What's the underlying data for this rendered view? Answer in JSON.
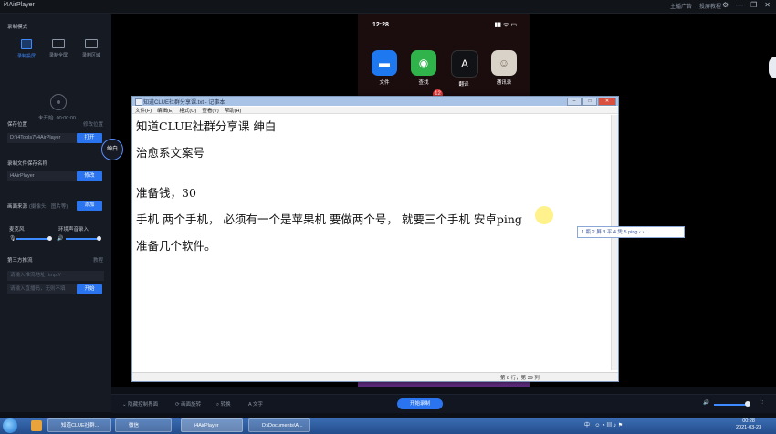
{
  "app": {
    "title": "i4AirPlayer"
  },
  "titlebar": {
    "links": [
      "主播广告",
      "投屏教程"
    ],
    "controls": [
      "⚙",
      "—",
      "❐",
      "✕"
    ]
  },
  "sidebar": {
    "record_mode_title": "录制模式",
    "modes": [
      {
        "label": "录制投屏",
        "active": true
      },
      {
        "label": "录制全屏",
        "active": false
      },
      {
        "label": "录制区域",
        "active": false
      }
    ],
    "record_status": "未开始",
    "record_time": "00:00:00",
    "save_location": {
      "title": "保存位置",
      "open_link": "修改位置",
      "path": "D:\\i4Tools7\\i4AirPlayer",
      "button": "打开"
    },
    "filename": {
      "title": "录制文件保存名称",
      "value": "i4AirPlayer",
      "button": "修改"
    },
    "image_source": {
      "title": "画面来源",
      "placeholder": "(摄像头、图片等)",
      "button": "添加"
    },
    "mic": {
      "label": "麦克风",
      "level": 0.95
    },
    "ambient": {
      "label": "环境声音录入",
      "level": 0.95
    },
    "third_party": {
      "title": "第三方推流",
      "link": "教程",
      "url_placeholder": "请输入推流地址 rtmp://",
      "key_placeholder": "请输入直播码，无则不填",
      "button": "开始"
    }
  },
  "phone": {
    "time": "12:28",
    "status_icons": "▮▮ ᯤ ▭",
    "apps": [
      {
        "label": "文件",
        "icon": "folder-icon",
        "color": "#1e78f0",
        "glyph": "▬"
      },
      {
        "label": "查找",
        "icon": "find-my-icon",
        "color": "#2fb34a",
        "glyph": "◉"
      },
      {
        "label": "翻译",
        "icon": "translate-icon",
        "color": "#101216",
        "glyph": "A"
      },
      {
        "label": "通讯录",
        "icon": "contacts-icon",
        "color": "#d8d2c8",
        "glyph": "☺"
      }
    ],
    "badge": "12"
  },
  "notepad": {
    "title": "知道CLUE社群分享课.txt - 记事本",
    "menu": [
      "文件(F)",
      "编辑(E)",
      "格式(O)",
      "查看(V)",
      "帮助(H)"
    ],
    "lines": [
      "知道CLUE社群分享课   绅白",
      "治愈系文案号",
      "准备钱，30",
      "手机 两个手机，  必须有一个是苹果机  要做两个号，  就要三个手机  安卓ping",
      "准备几个软件。"
    ],
    "status": "第 8 行，第 39 列"
  },
  "ime": {
    "candidates": "1.瓶 2.屏 3.平 4.凭 5.ping  ‹ ›"
  },
  "bubble": {
    "label": "绅白"
  },
  "bottombar": {
    "items": [
      "隐藏控制界面",
      "画面旋转",
      "转换",
      "文字"
    ],
    "start_button": "开始录制"
  },
  "taskbar": {
    "windows": [
      "知道CLUE社群...",
      "微信",
      "i4AirPlayer",
      "D:\\Documents\\A..."
    ],
    "tray": "中 · ☺ ◔ ▤ ♪ ⚑",
    "time": "00:28",
    "date": "2021-03-23"
  }
}
